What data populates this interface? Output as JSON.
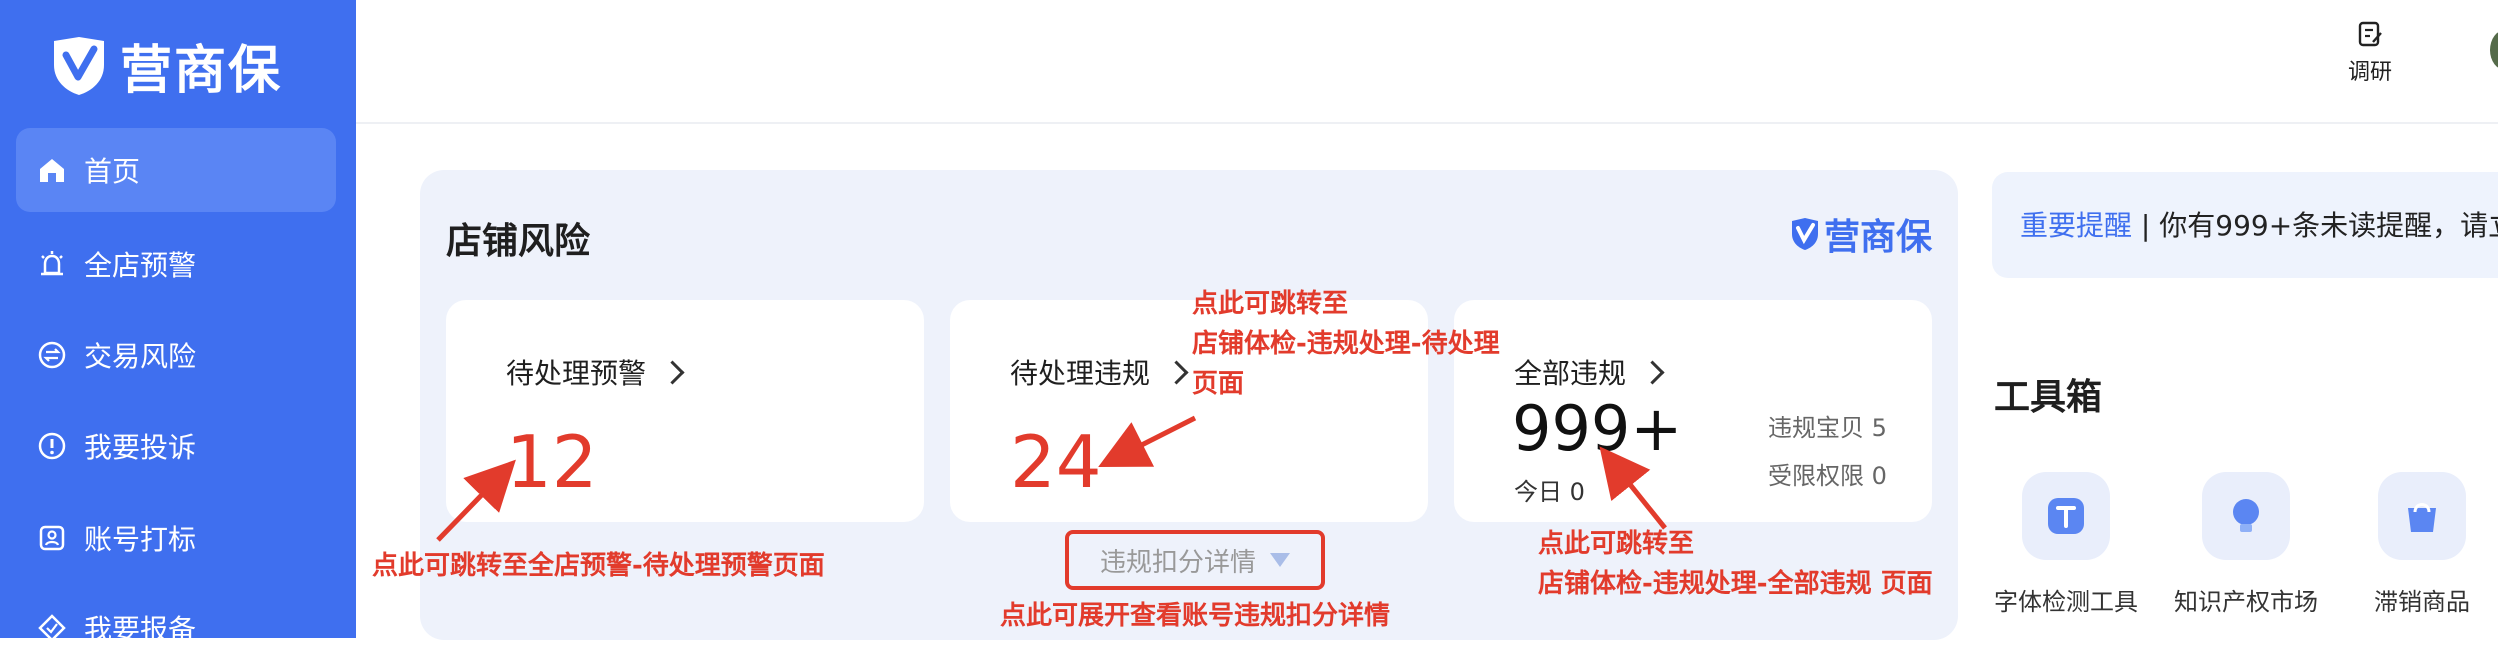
{
  "brand": {
    "name": "营商保"
  },
  "sidebar": {
    "items": [
      {
        "label": "首页",
        "icon": "home-icon",
        "active": true
      },
      {
        "label": "全店预警",
        "icon": "alarm-bell-icon"
      },
      {
        "label": "交易风险",
        "icon": "exchange-icon"
      },
      {
        "label": "我要投诉",
        "icon": "alert-circle-icon"
      },
      {
        "label": "账号打标",
        "icon": "tag-icon"
      },
      {
        "label": "我要报备",
        "icon": "report-icon"
      }
    ]
  },
  "topbar": {
    "survey_label": "调研"
  },
  "risk": {
    "title": "店铺风险",
    "logo_text": "营商保",
    "pending_alerts": {
      "label": "待处理预警",
      "value": "12"
    },
    "pending_violations": {
      "label": "待处理违规",
      "value": "24"
    },
    "all_violations": {
      "label": "全部违规",
      "value": "999+",
      "today": "今日 0",
      "items_violation": "违规宝贝 5",
      "restricted": "受限权限 0"
    },
    "detail_button": "违规扣分详情"
  },
  "annotations": {
    "a1": "点此可跳转至全店预警-待处理预警页面",
    "a2_l1": "点此可跳转至",
    "a2_l2": "店铺体检-违规处理-待处理",
    "a2_l3": "页面",
    "a3_l1": "点此可跳转至",
    "a3_l2": "店铺体检-违规处理-全部违规 页面",
    "a4": "点此可展开查看账号违规扣分详情"
  },
  "notice": {
    "highlight": "重要提醒",
    "separator": " | ",
    "text": "你有999+条未读提醒，请立"
  },
  "toolbox": {
    "title": "工具箱",
    "tools": [
      {
        "label": "字体检测工具",
        "icon": "font-check-icon"
      },
      {
        "label": "知识产权市场",
        "icon": "lightbulb-icon"
      },
      {
        "label": "滞销商品",
        "icon": "shopping-bag-icon"
      }
    ]
  },
  "colors": {
    "brand_blue": "#3f6fef",
    "alert_red": "#e23b2c",
    "panel_bg": "#eef2fb"
  }
}
